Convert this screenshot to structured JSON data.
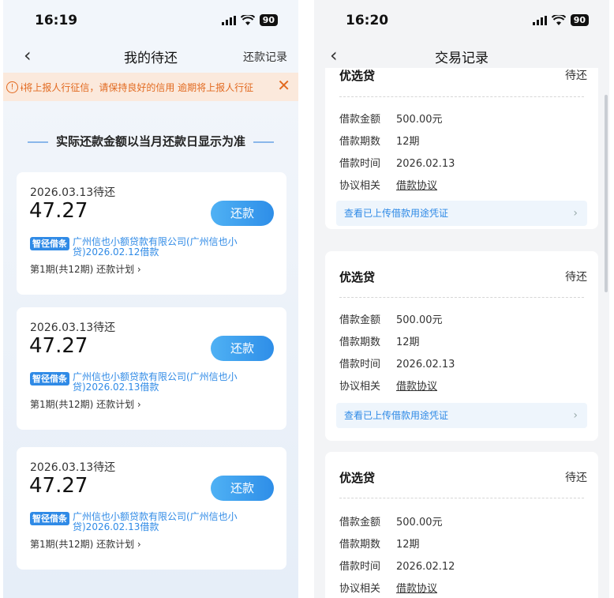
{
  "left": {
    "status": {
      "time": "16:19",
      "battery": "90"
    },
    "nav": {
      "title": "我的待还",
      "right_link": "还款记录"
    },
    "notice": {
      "text": "ɨ将上报人行征信，请保持良好的信用   逾期将上报人行征",
      "close": "✕"
    },
    "heading": "实际还款金额以当月还款日显示为准",
    "cards": [
      {
        "due": "2026.03.13待还",
        "amount": "47.27",
        "button": "还款",
        "tag": "智径借条",
        "lender": "广州信也小额贷款有限公司(广州信也小贷)2026.02.12借款",
        "period": "第1期(共12期)  还款计划 ›"
      },
      {
        "due": "2026.03.13待还",
        "amount": "47.27",
        "button": "还款",
        "tag": "智径借条",
        "lender": "广州信也小额贷款有限公司(广州信也小贷)2026.02.13借款",
        "period": "第1期(共12期)  还款计划 ›"
      },
      {
        "due": "2026.03.13待还",
        "amount": "47.27",
        "button": "还款",
        "tag": "智径借条",
        "lender": "广州信也小额贷款有限公司(广州信也小贷)2026.02.13借款",
        "period": "第1期(共12期)  还款计划 ›"
      }
    ]
  },
  "right": {
    "status": {
      "time": "16:20",
      "battery": "90"
    },
    "nav": {
      "title": "交易记录"
    },
    "partial": {
      "title": "优选贷",
      "status": "待还",
      "rows": [
        {
          "k": "借款金额",
          "v": "500.00元"
        },
        {
          "k": "借款期数",
          "v": "12期"
        },
        {
          "k": "借款时间",
          "v": "2026.02.13"
        },
        {
          "k": "协议相关",
          "v": "借款协议"
        }
      ],
      "voucher": "查看已上传借款用途凭证"
    },
    "records": [
      {
        "title": "优选贷",
        "status": "待还",
        "rows": [
          {
            "k": "借款金额",
            "v": "500.00元"
          },
          {
            "k": "借款期数",
            "v": "12期"
          },
          {
            "k": "借款时间",
            "v": "2026.02.13"
          },
          {
            "k": "协议相关",
            "v": "借款协议"
          }
        ],
        "voucher": "查看已上传借款用途凭证"
      },
      {
        "title": "优选贷",
        "status": "待还",
        "rows": [
          {
            "k": "借款金额",
            "v": "500.00元"
          },
          {
            "k": "借款期数",
            "v": "12期"
          },
          {
            "k": "借款时间",
            "v": "2026.02.12"
          },
          {
            "k": "协议相关",
            "v": "借款协议"
          }
        ]
      }
    ]
  }
}
